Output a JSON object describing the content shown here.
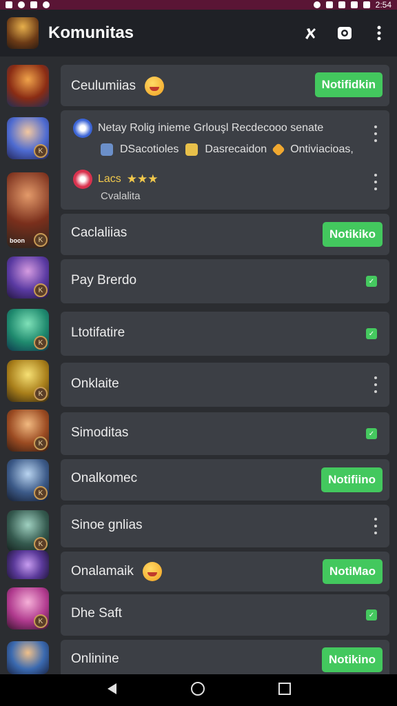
{
  "status_bar": {
    "time": "2:54"
  },
  "app_bar": {
    "title": "Komunitas",
    "icons": [
      "hero-icon",
      "camera-icon",
      "more-vert-icon"
    ]
  },
  "colors": {
    "accent_green": "#43c85e",
    "card": "#3c3f45",
    "background": "#2b2d31",
    "status_bar": "#5a1535"
  },
  "rows": [
    {
      "label": "Ceulumiias",
      "emoji": true,
      "action": "button",
      "button_label": "Notifidkin"
    },
    {
      "expanded": true,
      "line1": "Netay Rolig inieme Grlouşl Recdecooo senate",
      "sub_items": [
        {
          "icon": "camera-small-icon",
          "text": "DSacotioles"
        },
        {
          "icon": "box-icon",
          "text": "Dasrecaidon"
        },
        {
          "icon": "tag-icon",
          "text": "Ontiviacioas,"
        }
      ],
      "line2_title": "Lacs",
      "line2_stars": "★★★",
      "line2_sub": "Cvalalita"
    },
    {
      "label": "Caclaliias",
      "action": "button",
      "button_label": "Notikiko",
      "thumb_label": "boon"
    },
    {
      "label": "Pay Brerdo",
      "action": "check"
    },
    {
      "label": "Ltotifatire",
      "action": "check"
    },
    {
      "label": "Onklaite",
      "action": "menu"
    },
    {
      "label": "Simoditas",
      "action": "check"
    },
    {
      "label": "Onalkomec",
      "action": "button",
      "button_label": "Notifiino"
    },
    {
      "label": "Sinoe gnlias",
      "action": "menu"
    },
    {
      "label": "Onalamaik",
      "emoji": true,
      "action": "button",
      "button_label": "NotiMao"
    },
    {
      "label": "Dhe Saft",
      "action": "check"
    },
    {
      "label": "Onlinine",
      "action": "button",
      "button_label": "Notikino"
    }
  ],
  "nav": {
    "icons": [
      "back-icon",
      "home-icon",
      "recents-icon"
    ]
  }
}
